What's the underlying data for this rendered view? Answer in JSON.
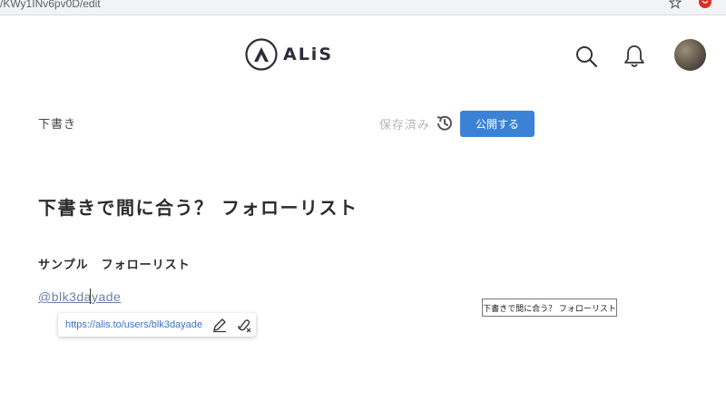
{
  "browser": {
    "url_fragment": "/KWy1INv6pv0D/edit"
  },
  "header": {
    "logo_text": "ALiS",
    "icons": [
      "search-icon",
      "bell-icon"
    ],
    "accent_color": "#3b82d6"
  },
  "toolbar": {
    "draft_label": "下書き",
    "saved_status": "保存済み",
    "publish_label": "公開する"
  },
  "article": {
    "title": "下書きで間に合う？ フォローリスト",
    "subheading": "サンプル　フォローリスト",
    "mention": "@blk3dayade"
  },
  "link_popover": {
    "url": "https://alis.to/users/blk3dayade"
  },
  "tooltip": {
    "text": "下書きで間に合う？ フォローリスト"
  }
}
